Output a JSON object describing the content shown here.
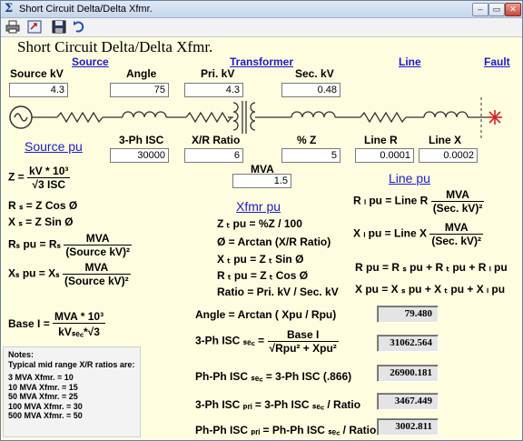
{
  "window": {
    "title": "Short Circuit Delta/Delta Xfmr.",
    "app_glyph": "Σ",
    "minimize": "–",
    "restore": "▭",
    "close": "✕"
  },
  "toolbar": {
    "icons": [
      "printer-icon",
      "export-icon",
      "save-icon",
      "undo-icon"
    ]
  },
  "heading": "Short Circuit Delta/Delta Xfmr.",
  "sections": {
    "source": "Source",
    "transformer": "Transformer",
    "line": "Line",
    "fault": "Fault"
  },
  "labels": {
    "source_kv": "Source  kV",
    "angle": "Angle",
    "pri_kv": "Pri. kV",
    "sec_kv": "Sec. kV",
    "isc": "3-Ph ISC",
    "xr": "X/R Ratio",
    "pz": "% Z",
    "line_r": "Line R",
    "line_x": "Line X",
    "mva": "MVA"
  },
  "inputs": {
    "source_kv": "4.3",
    "angle": "75",
    "pri_kv": "4.3",
    "sec_kv": "0.48",
    "isc": "30000",
    "xr": "6",
    "pz": "5",
    "line_r": "0.0001",
    "line_x": "0.0002",
    "mva": "1.5"
  },
  "headers": {
    "source_pu": "Source pu",
    "xfmr_pu": "Xfmr pu",
    "line_pu": "Line pu"
  },
  "formulas": {
    "z_lhs": "Z  =",
    "z_num": "kV * 10³",
    "z_den": "√3  ISC",
    "rs": "R ₛ = Z Cos Ø",
    "xs": "X ₛ = Z  Sin Ø",
    "rspu_lhs": "Rₛ pu = Rₛ",
    "xspu_lhs": "Xₛ pu = Xₛ",
    "mva_num": "MVA",
    "src_den": "(Source kV)²",
    "base_lhs": "Base I  =",
    "base_num": "MVA * 10³",
    "base_den": "kVₛₑ꜀*√3",
    "zt": "Z ₜ pu = %Z / 100",
    "phi": "Ø = Arctan (X/R Ratio)",
    "xt": "X ₜ pu = Z ₜ Sin  Ø",
    "rt": "R ₜ pu = Z ₜ Cos  Ø",
    "ratio": "Ratio = Pri. kV / Sec. kV",
    "rl_lhs": "R ₗ pu = Line R",
    "xl_lhs": "X ₗ pu = Line X",
    "sec_den": "(Sec. kV)²",
    "rpu": "R pu = R ₛ pu + R ₜ pu + R ₗ pu",
    "xpu": "X pu = X ₛ pu + X ₜ pu + X ₗ pu",
    "angle": "Angle = Arctan ( Xpu / Rpu)",
    "isc_lhs": "3-Ph ISC ₛₑ꜀ =",
    "isc_num": "Base I",
    "isc_den": "Rpu² + Xpu²",
    "phph": "Ph-Ph ISC ₛₑ꜀ = 3-Ph ISC (.866)",
    "isc_pri": "3-Ph ISC ₚᵣᵢ =  3-Ph ISC ₛₑ꜀ / Ratio",
    "phph_pri": "Ph-Ph ISC ₚᵣᵢ =  Ph-Ph ISC ₛₑ꜀ / Ratio"
  },
  "results": {
    "angle": "79.480",
    "isc_sec": "31062.564",
    "phph_sec": "26900.181",
    "isc_pri": "3467.449",
    "phph_pri": "3002.811"
  },
  "notes": {
    "title": "Notes:",
    "subtitle": "Typical mid range X/R ratios are:",
    "items": [
      "3 MVA Xfmr. = 10",
      "10 MVA Xfmr. = 15",
      "50 MVA Xfmr. = 25",
      "100 MVA Xfmr. = 30",
      "500 MVA Xfmr. = 50"
    ]
  },
  "colors": {
    "accent": "#1b1bd1",
    "background": "#fffde0",
    "fault": "#d22222"
  }
}
